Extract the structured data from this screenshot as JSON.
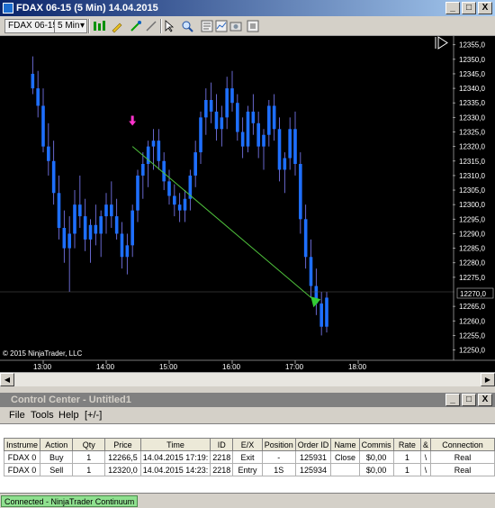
{
  "chart_window": {
    "title": "FDAX 06-15 (5 Min)  14.04.2015",
    "controls": [
      "_",
      "□",
      "X"
    ]
  },
  "toolbar": {
    "instrument": "FDAX 06-15",
    "interval": "5 Min"
  },
  "chart": {
    "copyright": "© 2015 NinjaTrader, LLC",
    "last_price_label": "12270,0",
    "y_ticks": [
      "12355,0",
      "12350,0",
      "12345,0",
      "12340,0",
      "12335,0",
      "12330,0",
      "12325,0",
      "12320,0",
      "12315,0",
      "12310,0",
      "12305,0",
      "12300,0",
      "12295,0",
      "12290,0",
      "12285,0",
      "12280,0",
      "12275,0",
      "12265,0",
      "12260,0",
      "12255,0",
      "12250,0"
    ],
    "x_ticks": [
      "13:00",
      "14:00",
      "15:00",
      "16:00",
      "17:00",
      "18:00"
    ],
    "colors": {
      "background": "#000000",
      "candle": "#1e6fff",
      "wick": "#8080ff",
      "trade_line": "#4fc23c",
      "entry_marker": "#ff33cc",
      "exit_marker": "#33cc33"
    }
  },
  "chart_data": {
    "type": "candlestick",
    "y_range": [
      12248,
      12358
    ],
    "x_range": [
      "12:45",
      "18:30"
    ],
    "trade_line": {
      "from": [
        "14:25",
        12320.0
      ],
      "to": [
        "17:20",
        12266.5
      ]
    },
    "entry_marker": {
      "time": "14:25",
      "price": 12325
    },
    "exit_marker": {
      "time": "17:20",
      "price": 12266.5
    }
  },
  "control_center": {
    "title": "Control Center - Untitled1",
    "menu": [
      "File",
      "Tools",
      "Help",
      "[+/-]"
    ],
    "columns": [
      "Instrume",
      "Action",
      "Qty",
      "Price",
      "Time",
      "ID",
      "E/X",
      "Position",
      "Order ID",
      "Name",
      "Commis",
      "Rate",
      "&",
      "Connection"
    ],
    "rows": [
      [
        "FDAX 0",
        "Buy",
        "1",
        "12266,5",
        "14.04.2015 17:19:",
        "2218",
        "Exit",
        "-",
        "125931",
        "Close",
        "$0,00",
        "1",
        "\\",
        "Real"
      ],
      [
        "FDAX 0",
        "Sell",
        "1",
        "12320,0",
        "14.04.2015 14:23:",
        "2218",
        "Entry",
        "1S",
        "125934",
        "",
        "$0,00",
        "1",
        "\\",
        "Real"
      ]
    ]
  },
  "status": {
    "connection": "Connected - NinjaTrader Continuum"
  }
}
